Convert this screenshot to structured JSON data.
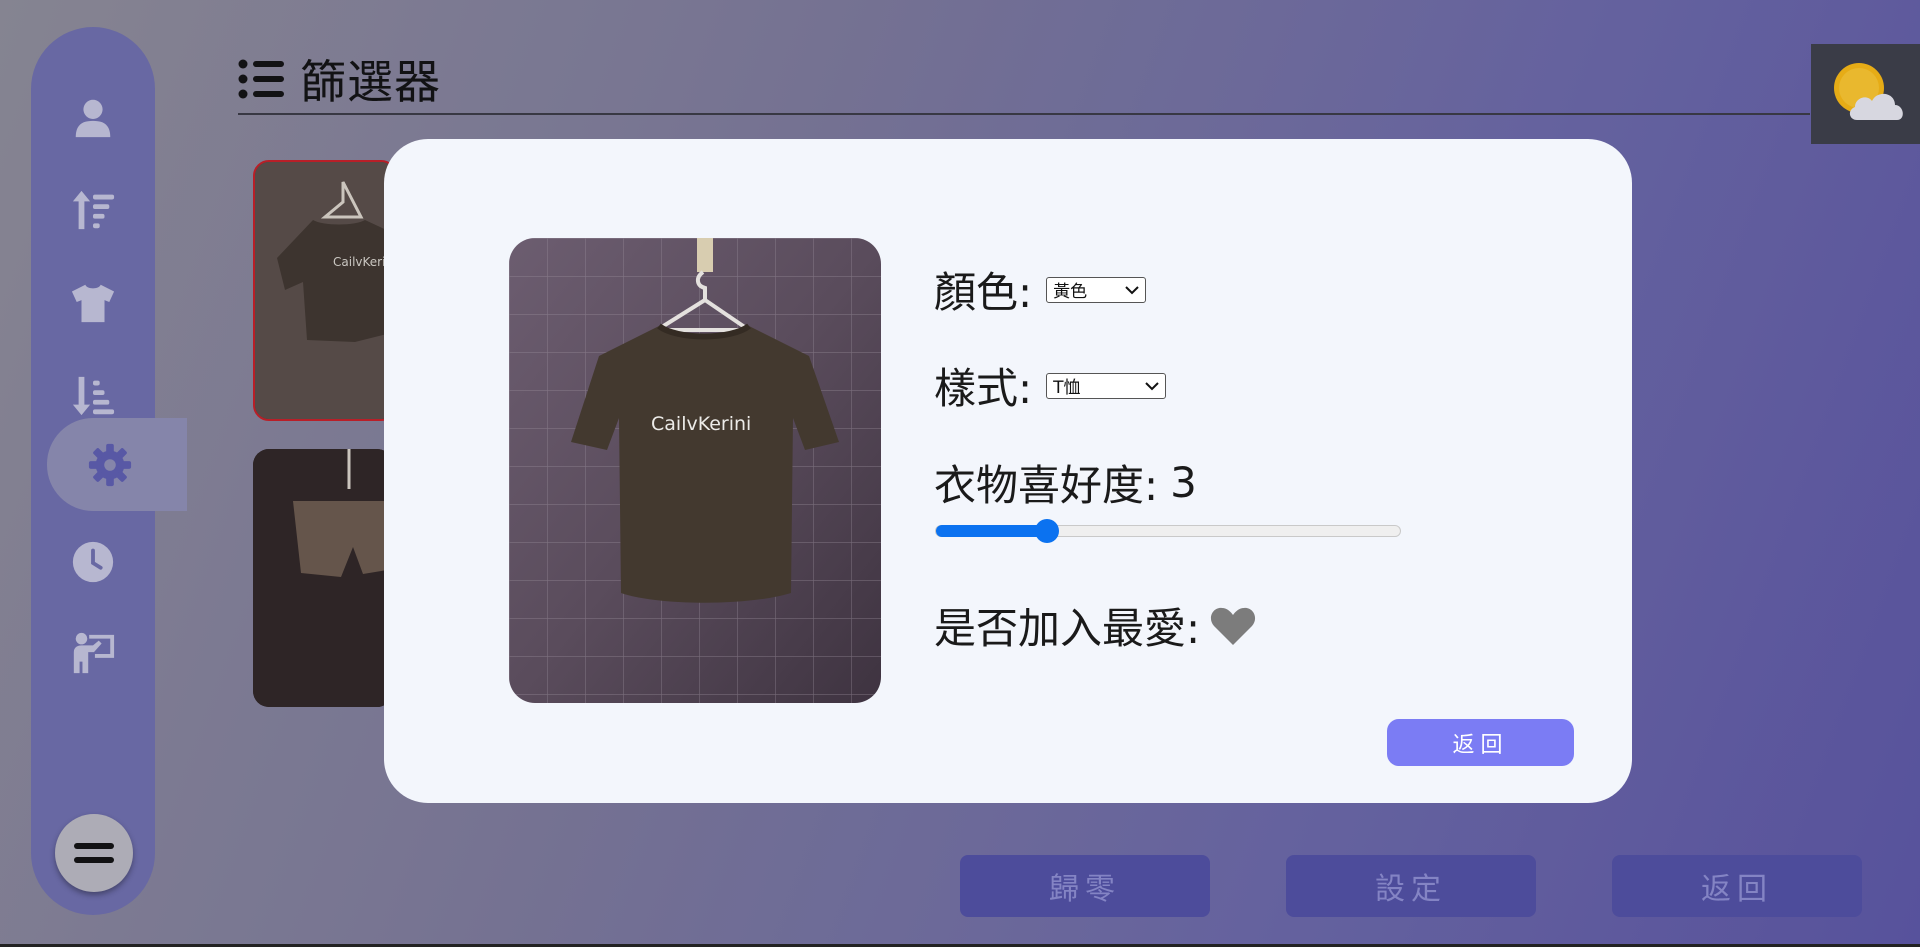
{
  "header": {
    "title": "篩選器",
    "icon": "list-icon"
  },
  "sidebar": {
    "items": [
      {
        "name": "user-icon"
      },
      {
        "name": "sort-ascending-icon"
      },
      {
        "name": "shirt-icon"
      },
      {
        "name": "sort-descending-icon"
      },
      {
        "name": "gear-icon",
        "active": true
      },
      {
        "name": "clock-icon"
      },
      {
        "name": "presenter-icon"
      }
    ],
    "menu_button_icon": "equals-icon"
  },
  "weather": {
    "icon": "partly-cloudy-icon"
  },
  "bottom_buttons": {
    "reset": "歸零",
    "settings": "設定",
    "back": "返回"
  },
  "modal": {
    "color_label": "顏色:",
    "color_value": "黃色",
    "style_label": "樣式:",
    "style_value": "T恤",
    "preference_label": "衣物喜好度:",
    "preference_value": "3",
    "preference_fraction": 0.24,
    "favorite_label": "是否加入最愛:",
    "favorite_icon": "heart-icon",
    "shirt_print": "CailvKerini",
    "back_button": "返回"
  },
  "colors": {
    "accent": "#0b72f0",
    "modal_button": "#7b7cf4",
    "sidebar": "#6e6eac",
    "bottom_button": "#5150a3",
    "selected_card_border": "#c51f26"
  }
}
